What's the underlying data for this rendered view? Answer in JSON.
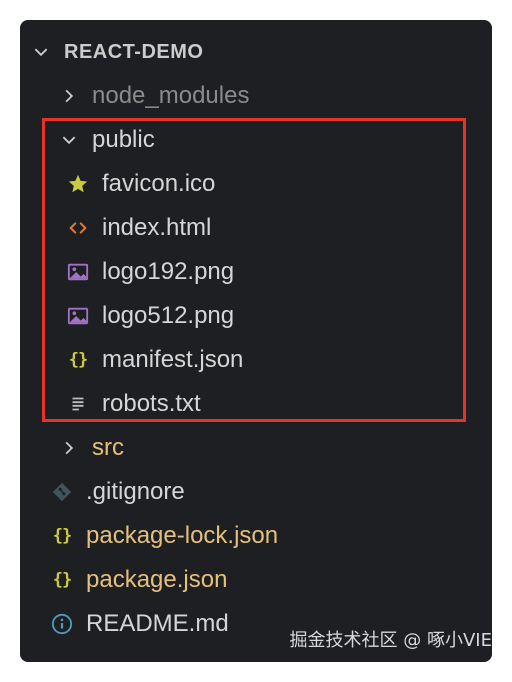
{
  "explorer": {
    "root_label": "REACT-DEMO",
    "items": [
      {
        "label": "node_modules",
        "icon": "chevron-right-icon"
      },
      {
        "label": "public",
        "icon": "chevron-down-icon"
      },
      {
        "label": "favicon.ico",
        "icon": "star-icon"
      },
      {
        "label": "index.html",
        "icon": "html-code-icon"
      },
      {
        "label": "logo192.png",
        "icon": "image-icon"
      },
      {
        "label": "logo512.png",
        "icon": "image-icon"
      },
      {
        "label": "manifest.json",
        "icon": "json-braces-icon"
      },
      {
        "label": "robots.txt",
        "icon": "text-file-icon"
      },
      {
        "label": "src",
        "icon": "chevron-right-icon"
      },
      {
        "label": ".gitignore",
        "icon": "git-icon"
      },
      {
        "label": "package-lock.json",
        "icon": "json-braces-icon"
      },
      {
        "label": "package.json",
        "icon": "json-braces-icon"
      },
      {
        "label": "README.md",
        "icon": "info-icon"
      }
    ]
  },
  "watermark": "掘金技术社区 @ 啄小VIE",
  "colors": {
    "panel_bg": "#1e1f22",
    "highlight_border": "#e5332a",
    "modified_text": "#e5c07b",
    "json_icon": "#cbcb41",
    "html_icon": "#e37933",
    "image_icon": "#a074c4",
    "info_icon": "#519aba"
  }
}
